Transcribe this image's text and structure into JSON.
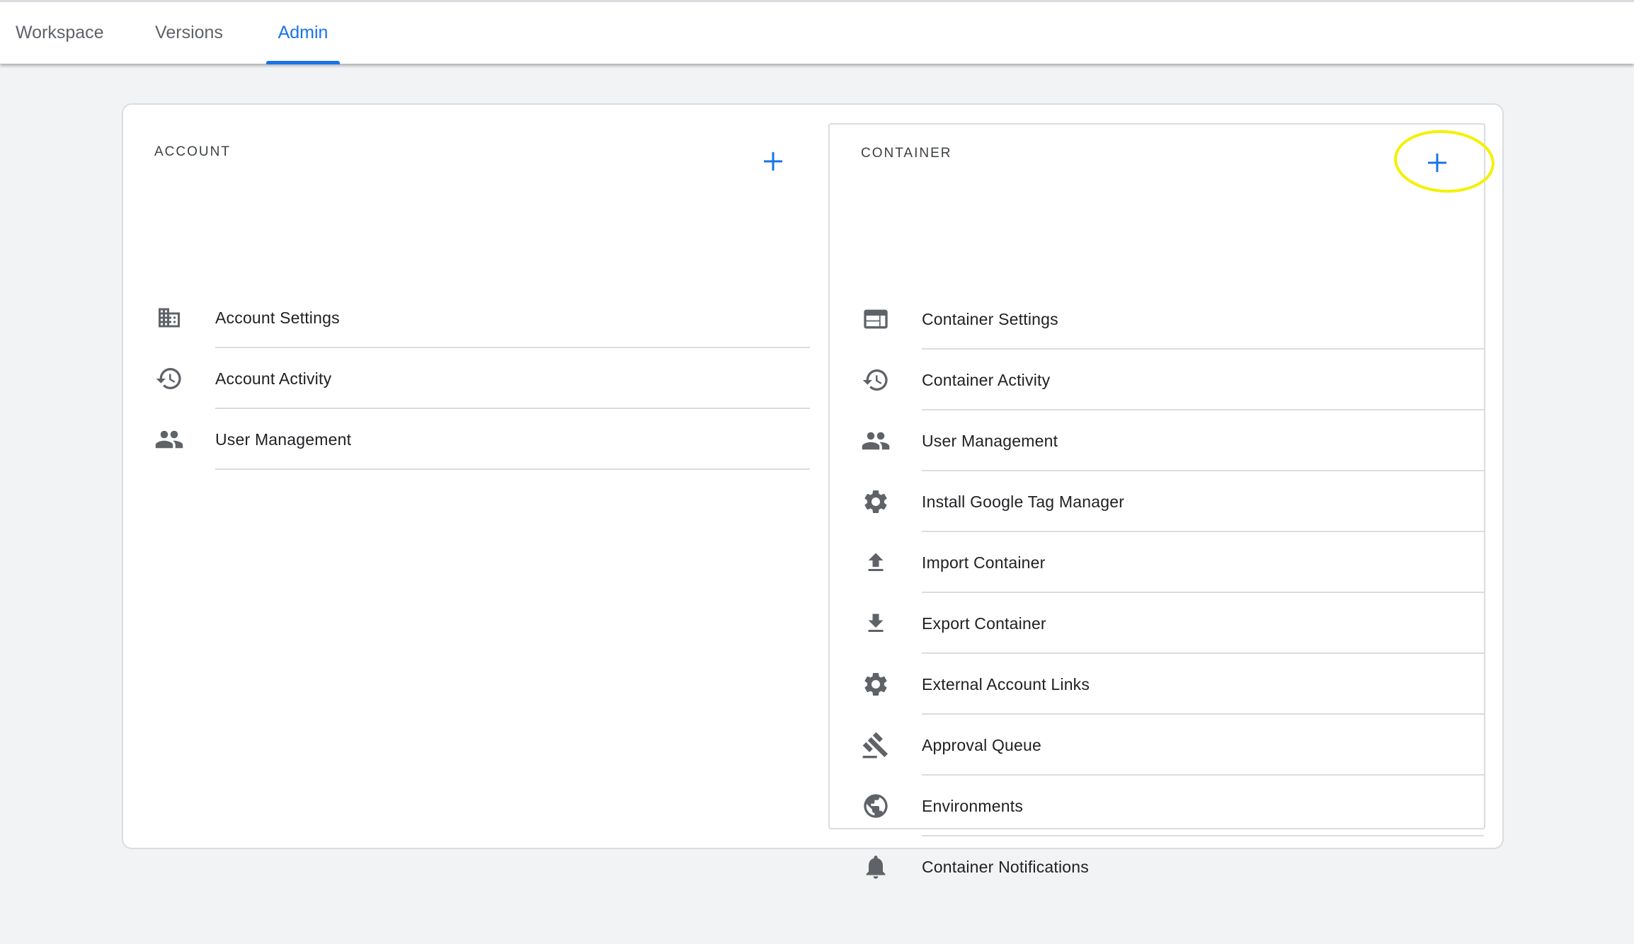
{
  "tabs": [
    {
      "label": "Workspace",
      "active": false
    },
    {
      "label": "Versions",
      "active": false
    },
    {
      "label": "Admin",
      "active": true
    }
  ],
  "colors": {
    "accent": "#1a73e8",
    "icon": "#5f6368",
    "divider": "#dadce0",
    "background": "#f1f3f4",
    "highlight": "#f4f100"
  },
  "account": {
    "title": "ACCOUNT",
    "add_icon": "plus-icon",
    "items": [
      {
        "label": "Account Settings",
        "icon": "building-icon"
      },
      {
        "label": "Account Activity",
        "icon": "history-icon"
      },
      {
        "label": "User Management",
        "icon": "people-icon"
      }
    ]
  },
  "container": {
    "title": "CONTAINER",
    "add_icon": "plus-icon",
    "items": [
      {
        "label": "Container Settings",
        "icon": "web-window-icon"
      },
      {
        "label": "Container Activity",
        "icon": "history-icon"
      },
      {
        "label": "User Management",
        "icon": "people-icon"
      },
      {
        "label": "Install Google Tag Manager",
        "icon": "gear-icon"
      },
      {
        "label": "Import Container",
        "icon": "upload-icon"
      },
      {
        "label": "Export Container",
        "icon": "download-icon"
      },
      {
        "label": "External Account Links",
        "icon": "gear-icon"
      },
      {
        "label": "Approval Queue",
        "icon": "gavel-icon"
      },
      {
        "label": "Environments",
        "icon": "globe-icon"
      },
      {
        "label": "Container Notifications",
        "icon": "bell-icon"
      }
    ]
  }
}
